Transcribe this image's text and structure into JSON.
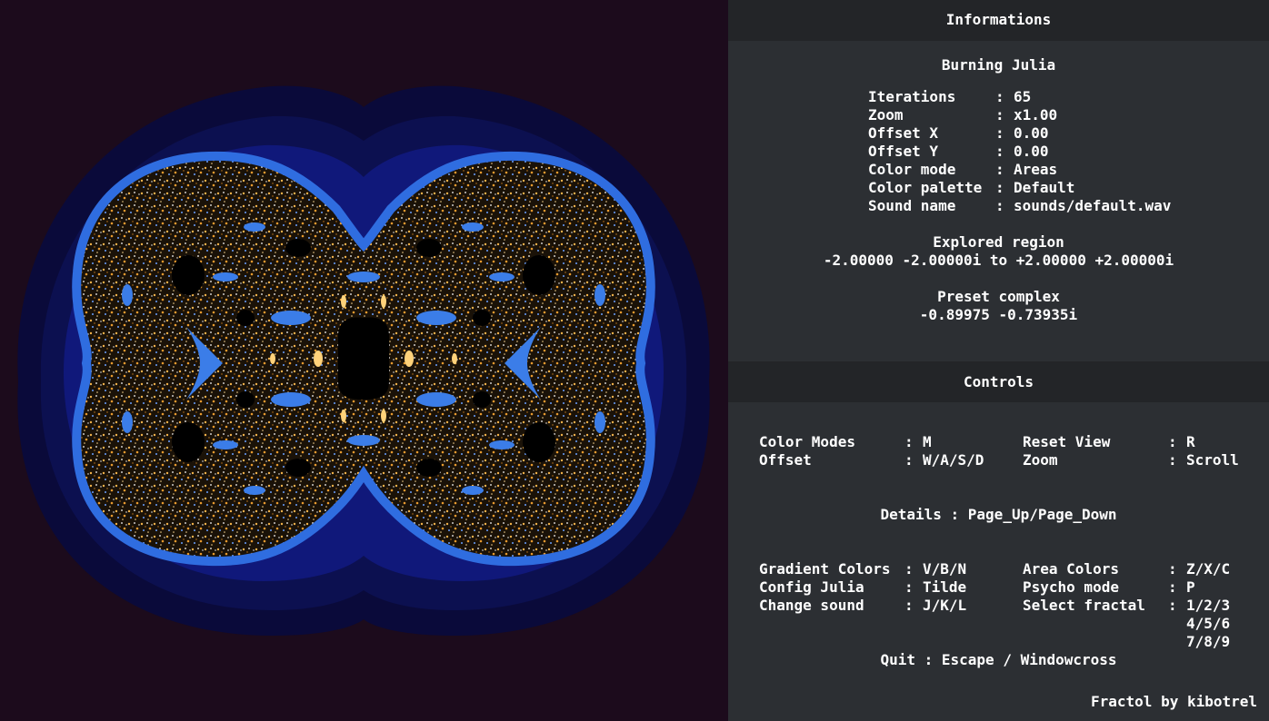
{
  "info_header": "Informations",
  "fractal_name": "Burning Julia",
  "info_rows": [
    {
      "label": "Iterations",
      "value": "65"
    },
    {
      "label": "Zoom",
      "value": "x1.00"
    },
    {
      "label": "Offset X",
      "value": "0.00"
    },
    {
      "label": "Offset Y",
      "value": "0.00"
    },
    {
      "label": "Color mode",
      "value": "Areas"
    },
    {
      "label": "Color palette",
      "value": "Default"
    },
    {
      "label": "Sound name",
      "value": "sounds/default.wav"
    }
  ],
  "explored_region_title": "Explored region",
  "explored_region_value": "-2.00000 -2.00000i to +2.00000 +2.00000i",
  "preset_complex_title": "Preset complex",
  "preset_complex_value": "-0.89975 -0.73935i",
  "controls_header": "Controls",
  "controls_top": [
    {
      "label": "Color Modes",
      "key": "M",
      "label2": "Reset View",
      "key2": "R"
    },
    {
      "label": "Offset",
      "key": "W/A/S/D",
      "label2": "Zoom",
      "key2": "Scroll"
    }
  ],
  "details_line": "Details : Page_Up/Page_Down",
  "controls_bottom": [
    {
      "label": "Gradient Colors",
      "key": "V/B/N",
      "label2": "Area Colors",
      "key2": "Z/X/C"
    },
    {
      "label": "Config Julia",
      "key": "Tilde",
      "label2": "Psycho mode",
      "key2": "P"
    },
    {
      "label": "Change sound",
      "key": "J/K/L",
      "label2": "Select fractal",
      "key2": "1/2/3"
    }
  ],
  "select_fractal_extra": [
    "4/5/6",
    "7/8/9"
  ],
  "quit_line": "Quit : Escape / Windowcross",
  "credit": "Fractol by kibotrel",
  "colors": {
    "background": "#1c0b1c",
    "panel": "#2c2f33",
    "panel_header": "#232528",
    "fractal_blue": "#1a3fb0",
    "fractal_gold": "#f0b040"
  }
}
